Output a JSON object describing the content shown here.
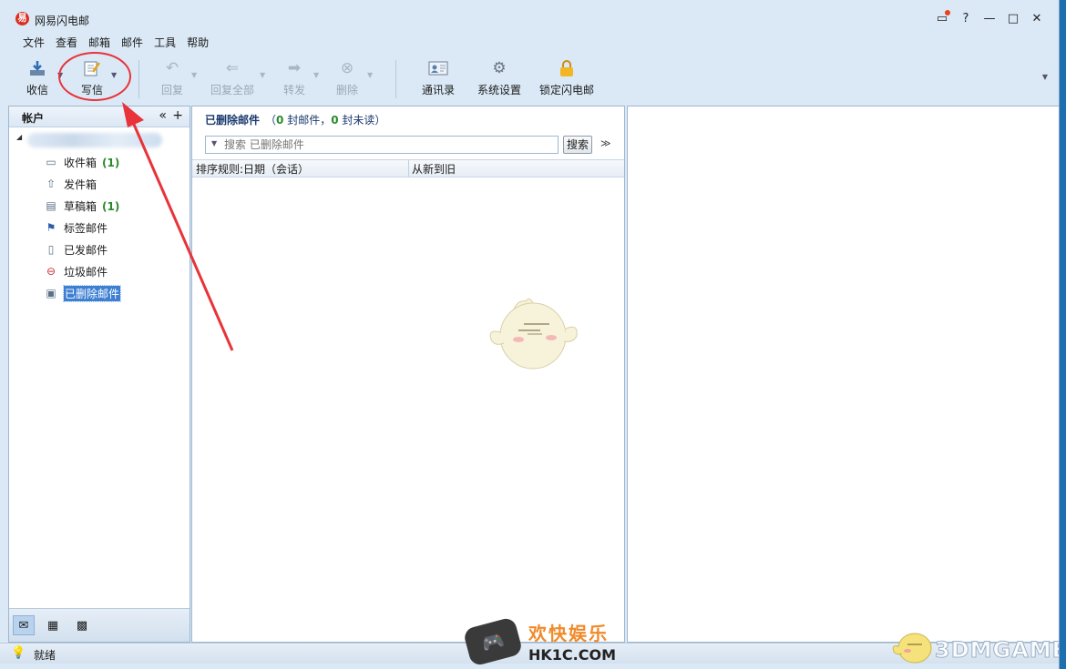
{
  "app": {
    "title": "网易闪电邮",
    "logo_glyph": "易"
  },
  "window_controls": {
    "minimize": "—",
    "maximize": "□",
    "close": "✕",
    "help": "?"
  },
  "menu": [
    "文件",
    "查看",
    "邮箱",
    "邮件",
    "工具",
    "帮助"
  ],
  "toolbar": {
    "receive": "收信",
    "compose": "写信",
    "reply": "回复",
    "reply_all": "回复全部",
    "forward": "转发",
    "delete": "删除",
    "contacts": "通讯录",
    "settings": "系统设置",
    "lock": "锁定闪电邮"
  },
  "sidebar": {
    "header": "帐户",
    "collapse": "«",
    "add": "+",
    "folders": [
      {
        "name": "收件箱",
        "count": "(1)",
        "icon": "inbox-icon"
      },
      {
        "name": "发件箱",
        "count": "",
        "icon": "outbox-icon"
      },
      {
        "name": "草稿箱",
        "count": "(1)",
        "icon": "drafts-icon"
      },
      {
        "name": "标签邮件",
        "count": "",
        "icon": "flag-icon"
      },
      {
        "name": "已发邮件",
        "count": "",
        "icon": "sent-icon"
      },
      {
        "name": "垃圾邮件",
        "count": "",
        "icon": "spam-icon"
      },
      {
        "name": "已删除邮件",
        "count": "",
        "icon": "trash-icon",
        "selected": true
      }
    ]
  },
  "list": {
    "folder_title": "已删除邮件",
    "info_open": "（",
    "total": "0",
    "info_mid": " 封邮件，",
    "unread": "0",
    "info_close": " 封未读）",
    "search_placeholder": "搜索 已删除邮件",
    "search_button": "搜索",
    "expand": "≫",
    "sort_column": "排序规则:日期（会话）",
    "order_column": "从新到旧"
  },
  "status": {
    "text": "就绪"
  },
  "watermarks": {
    "left_cn": "欢快娱乐",
    "left_en": "HK1C.COM",
    "right": "3DMGAME"
  },
  "colors": {
    "accent": "#3d7fd3",
    "count_green": "#2a8a2a",
    "annotation_red": "#e8333a"
  }
}
